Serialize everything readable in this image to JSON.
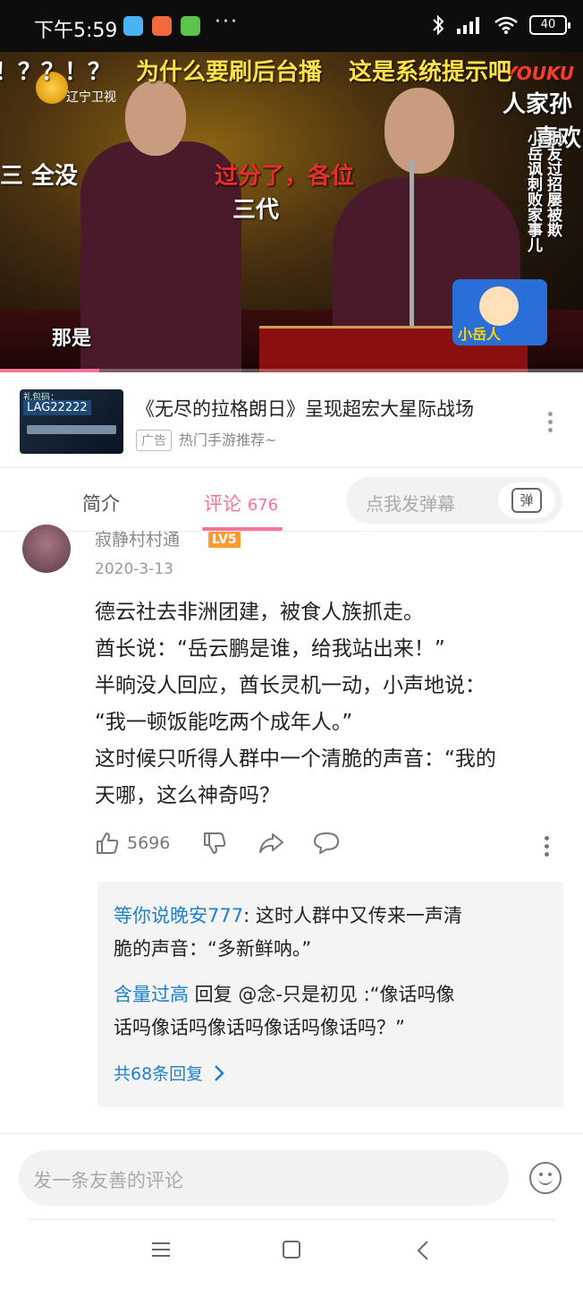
{
  "status_bar": {
    "time": "下午5:59",
    "more": "···",
    "battery": "40"
  },
  "video": {
    "channel": "辽宁卫视",
    "watermark": "YOUKU",
    "danmaku": [
      {
        "text": "！？？！？",
        "color": "#ffffff"
      },
      {
        "text": "为什么要刷后台播",
        "color": "#ffe14a"
      },
      {
        "text": "这是系统提示吧",
        "color": "#ffe14a"
      },
      {
        "text": "人家孙",
        "color": "#ffffff"
      },
      {
        "text": "喜欢",
        "color": "#ffffff"
      },
      {
        "text": "三 全没",
        "color": "#ffffff"
      },
      {
        "text": "过分了，各位",
        "color": "#e8302b"
      },
      {
        "text": "三代",
        "color": "#ffffff"
      },
      {
        "text": "那是",
        "color": "#ffffff"
      }
    ],
    "vertical_caption": [
      "小岳讽刺败家事儿",
      "损友过招屡被欺"
    ],
    "mascot_label": "小岳人",
    "progress": 0.17
  },
  "ad": {
    "thumb_code": "LAG22222",
    "thumb_tag": "礼包码：",
    "title": "《无尽的拉格朗日》呈现超宏大星际战场",
    "tag": "广告",
    "subtitle": "热门手游推荐~"
  },
  "tabs": {
    "intro": "简介",
    "comments": "评论",
    "comment_count": "676",
    "danmu_placeholder": "点我发弹幕",
    "danmu_icon_char": "弹"
  },
  "comment": {
    "username": "寂静村村通",
    "level": "LV5",
    "date": "2020-3-13",
    "lines": [
      "德云社去非洲团建，被食人族抓走。",
      "酋长说：“岳云鹏是谁，给我站出来！”",
      "半晌没人回应，酋长灵机一动，小声地说：",
      "“我一顿饭能吃两个成年人。”",
      "这时候只听得人群中一个清脆的声音：“我的",
      "天哪，这么神奇吗？"
    ],
    "likes": "5696",
    "replies": [
      {
        "name": "等你说晚安777",
        "text_line1": ": 这时人群中又传来一声清",
        "text_line2": "脆的声音：“多新鲜呐。”"
      },
      {
        "name": "含量过高",
        "text_line1": " 回复 @念-只是初见 :“像话吗像",
        "text_line2": "话吗像话吗像话吗像话吗像话吗？”"
      }
    ],
    "more_replies": "共68条回复"
  },
  "bottom": {
    "input_placeholder": "发一条友善的评论"
  },
  "colors": {
    "accent": "#fb7299",
    "link": "#1e82c8"
  }
}
